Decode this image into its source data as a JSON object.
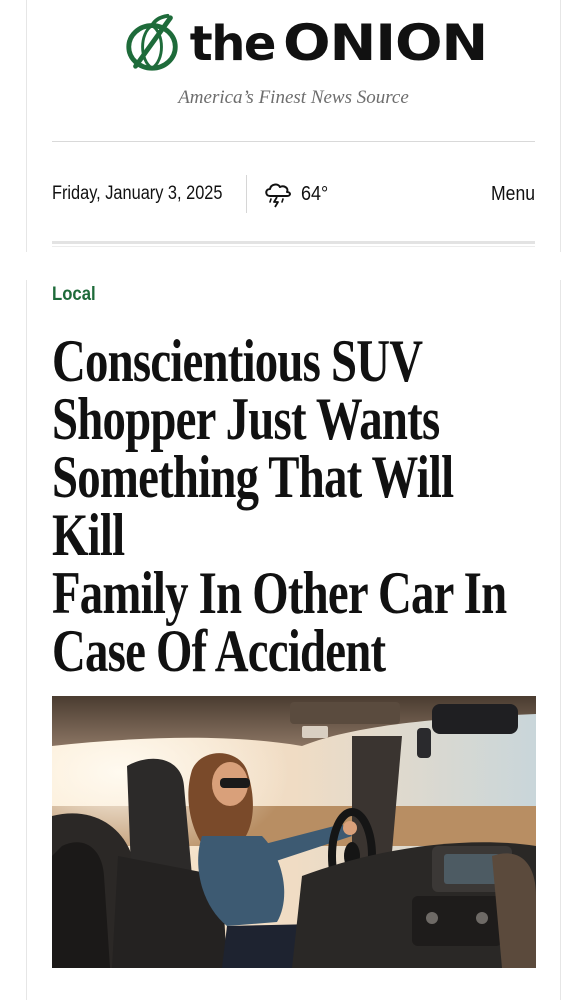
{
  "header": {
    "logo_text_the": "the",
    "logo_text_onion": "ONION",
    "tagline": "America’s Finest News Source",
    "date": "Friday, January 3, 2025",
    "weather": {
      "icon": "thunderstorm-cloud-icon",
      "temperature": "64°"
    },
    "menu_label": "Menu"
  },
  "article": {
    "section": "Local",
    "headline_lines": [
      "Conscientious SUV",
      "Shopper Just Wants",
      "Something That Will Kill",
      "Family In Other Car In",
      "Case Of Accident"
    ],
    "image": {
      "icon": "photo-woman-driving-suv"
    }
  },
  "colors": {
    "brand_green": "#1e6b3a",
    "text": "#111111",
    "tagline_gray": "#6d6d6d",
    "divider": "#d9d9d9"
  }
}
